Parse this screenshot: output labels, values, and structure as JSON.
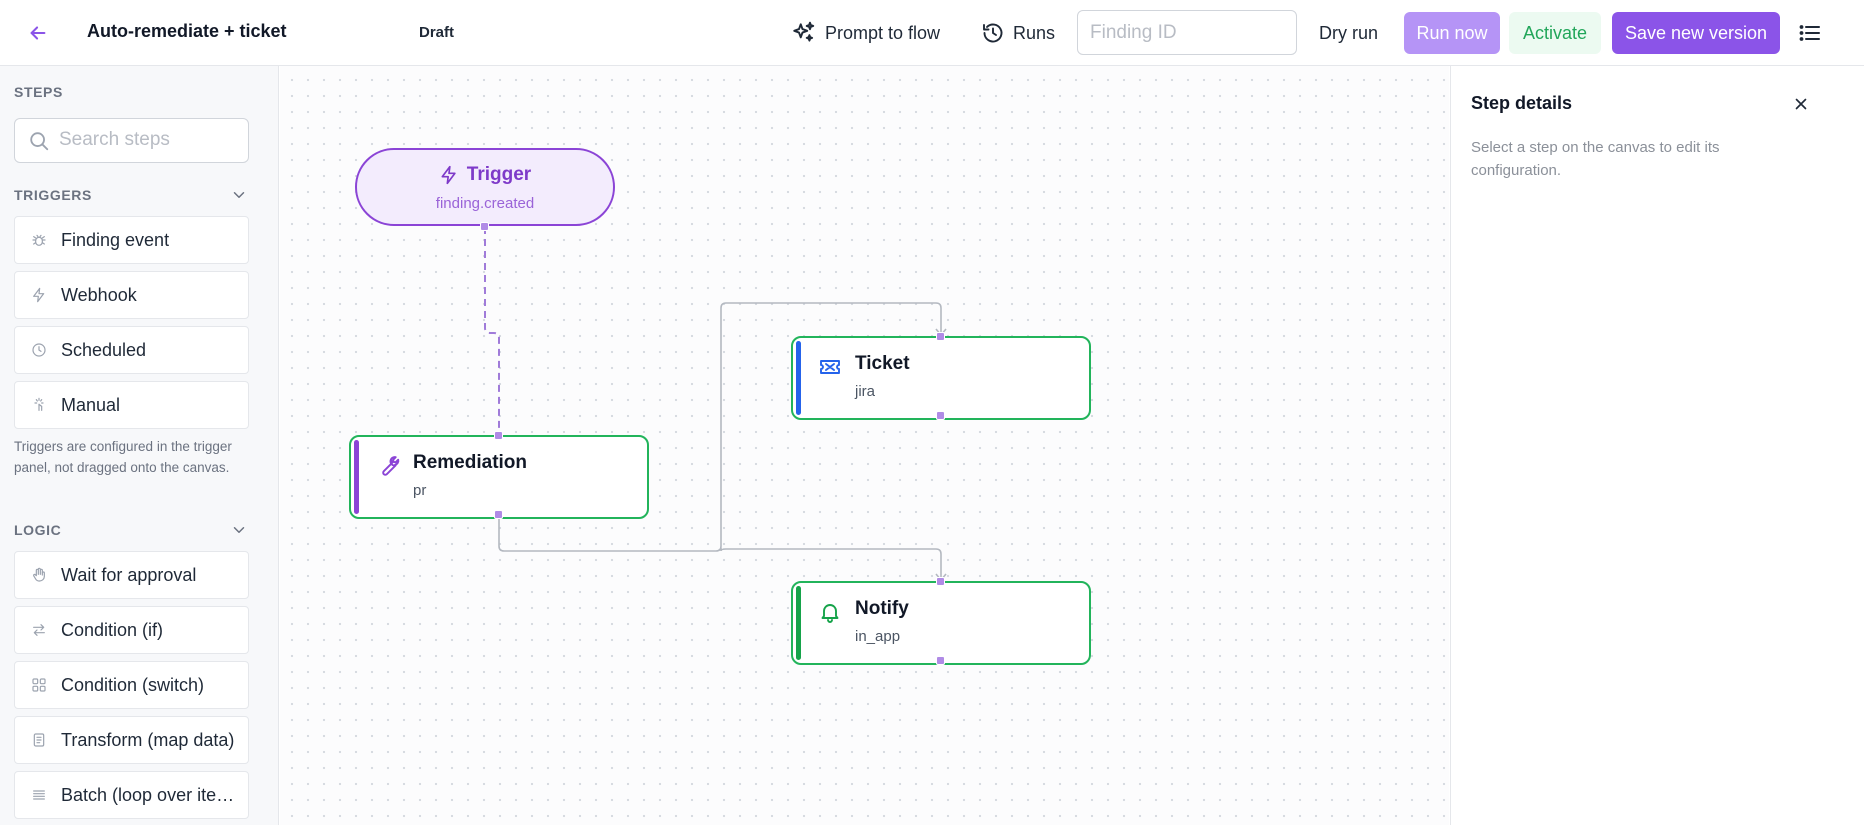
{
  "topbar": {
    "title": "Auto-remediate + ticket",
    "status": "Draft",
    "prompt_to_flow": "Prompt to flow",
    "runs": "Runs",
    "finding_id_placeholder": "Finding ID",
    "dry_run": "Dry run",
    "run_now": "Run now",
    "activate": "Activate",
    "save_new_version": "Save new version"
  },
  "sidebar": {
    "steps_heading": "STEPS",
    "search_placeholder": "Search steps",
    "triggers_heading": "TRIGGERS",
    "triggers": [
      {
        "label": "Finding event",
        "icon": "bug-icon"
      },
      {
        "label": "Webhook",
        "icon": "bolt-icon"
      },
      {
        "label": "Scheduled",
        "icon": "clock-icon"
      },
      {
        "label": "Manual",
        "icon": "tap-icon"
      }
    ],
    "triggers_note": "Triggers are configured in the trigger panel, not dragged onto the canvas.",
    "logic_heading": "LOGIC",
    "logic": [
      {
        "label": "Wait for approval",
        "icon": "hand-icon"
      },
      {
        "label": "Condition (if)",
        "icon": "arrows-icon"
      },
      {
        "label": "Condition (switch)",
        "icon": "grid-icon"
      },
      {
        "label": "Transform (map data)",
        "icon": "doc-icon"
      },
      {
        "label": "Batch (loop over items)",
        "icon": "list-icon"
      }
    ]
  },
  "canvas": {
    "trigger": {
      "title": "Trigger",
      "event": "finding.created"
    },
    "nodes": {
      "remediation": {
        "title": "Remediation",
        "subtitle": "pr",
        "icon": "wrench-icon"
      },
      "ticket": {
        "title": "Ticket",
        "subtitle": "jira",
        "icon": "ticket-icon"
      },
      "notify": {
        "title": "Notify",
        "subtitle": "in_app",
        "icon": "bell-icon"
      }
    }
  },
  "details_panel": {
    "title": "Step details",
    "description": "Select a step on the canvas to edit its configuration."
  },
  "colors": {
    "accent": "#8b54e8",
    "accent_light": "#b594f6",
    "success": "#22b45b",
    "ticket_bar": "#2563eb",
    "notify_bar": "#16a34a"
  }
}
